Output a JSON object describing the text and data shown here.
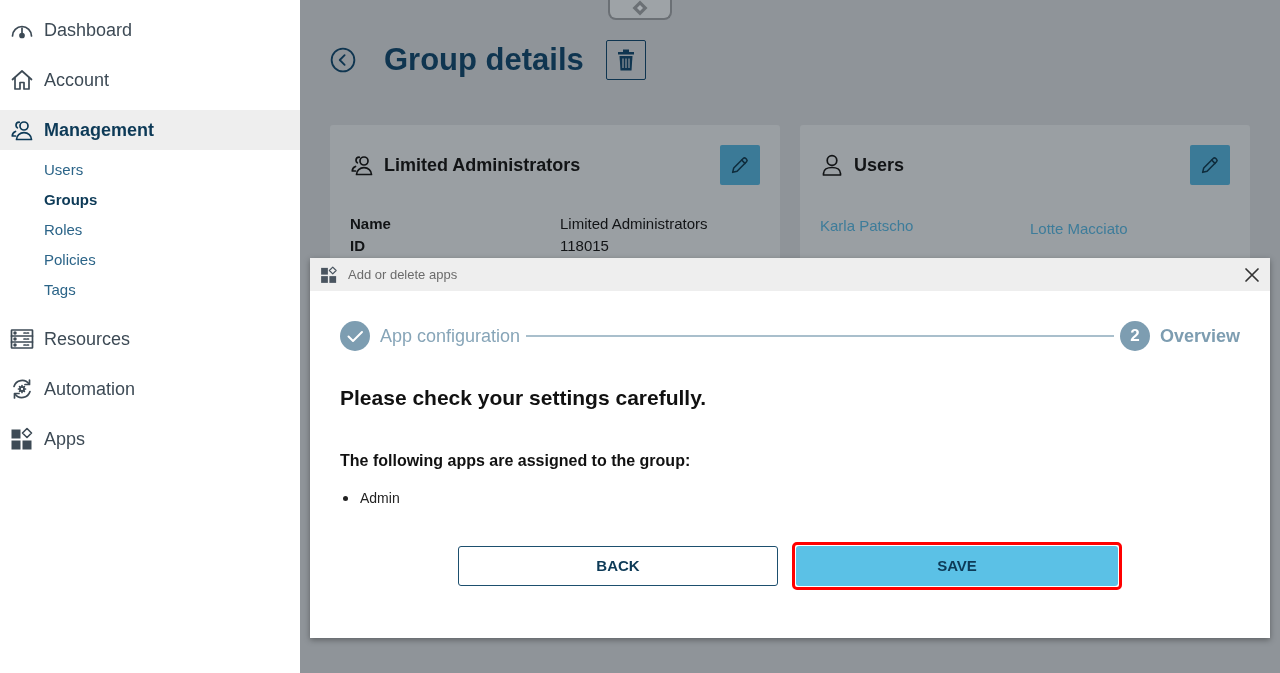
{
  "sidebar": {
    "items": [
      {
        "label": "Dashboard",
        "selected": false
      },
      {
        "label": "Account",
        "selected": false
      },
      {
        "label": "Management",
        "selected": true,
        "children": [
          {
            "label": "Users",
            "selected": false
          },
          {
            "label": "Groups",
            "selected": true
          },
          {
            "label": "Roles",
            "selected": false
          },
          {
            "label": "Policies",
            "selected": false
          },
          {
            "label": "Tags",
            "selected": false
          }
        ]
      },
      {
        "label": "Resources",
        "selected": false
      },
      {
        "label": "Automation",
        "selected": false
      },
      {
        "label": "Apps",
        "selected": false
      }
    ]
  },
  "page": {
    "title": "Group details"
  },
  "cards": [
    {
      "kind": "details",
      "title": "Limited Administrators",
      "rows": [
        {
          "label": "Name",
          "value": "Limited Administrators"
        },
        {
          "label": "ID",
          "value": "118015"
        }
      ]
    },
    {
      "kind": "links",
      "title": "Users",
      "links": [
        "Karla Patscho",
        "Lotte Macciato"
      ]
    }
  ],
  "dialog": {
    "title": "Add or delete apps",
    "steps": [
      {
        "label": "App configuration",
        "done": true
      },
      {
        "label": "Overview",
        "number": "2",
        "done": false
      }
    ],
    "heading": "Please check your settings carefully.",
    "subheading": "The following apps are assigned to the group:",
    "apps": [
      "Admin"
    ],
    "buttons": [
      {
        "label": "BACK",
        "kind": "secondary",
        "highlighted": false
      },
      {
        "label": "SAVE",
        "kind": "primary",
        "highlighted": true
      }
    ]
  }
}
